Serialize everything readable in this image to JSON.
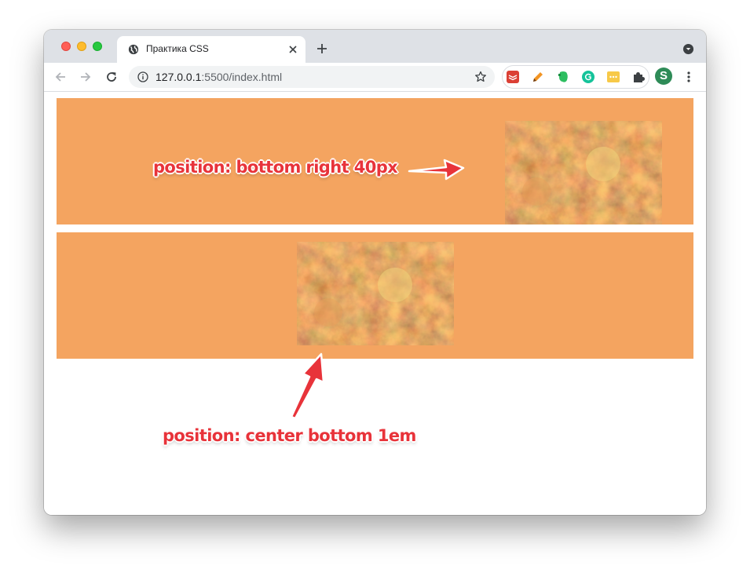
{
  "browser": {
    "tab_title": "Практика CSS",
    "url_host": "127.0.0.1",
    "url_rest": ":5500/index.html",
    "profile_initial": "S"
  },
  "page": {
    "box_color": "#f4a460",
    "annotations": {
      "first": "position: bottom right 40px",
      "second": "position: center bottom 1em",
      "color": "#e8333a"
    }
  }
}
